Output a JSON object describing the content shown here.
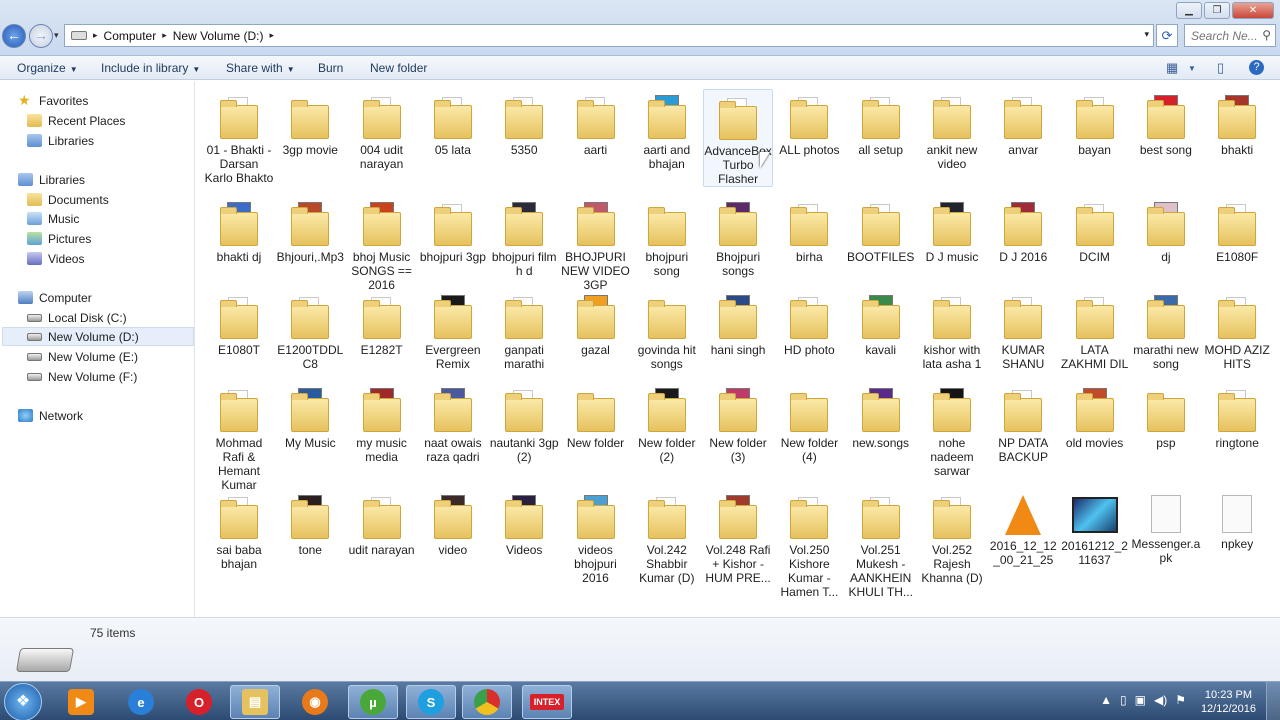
{
  "window": {
    "controls": [
      "minimize",
      "maximize",
      "close"
    ],
    "breadcrumbs": [
      "Computer",
      "New Volume (D:)"
    ],
    "search_placeholder": "Search Ne..."
  },
  "toolbar": {
    "organize": "Organize",
    "include": "Include in library",
    "share": "Share with",
    "burn": "Burn",
    "new_folder": "New folder"
  },
  "sidebar": {
    "favorites": "Favorites",
    "recent": "Recent Places",
    "libraries_fav": "Libraries",
    "libraries": "Libraries",
    "documents": "Documents",
    "music": "Music",
    "pictures": "Pictures",
    "videos": "Videos",
    "computer": "Computer",
    "local_c": "Local Disk (C:)",
    "new_d": "New Volume (D:)",
    "new_e": "New Volume (E:)",
    "new_f": "New Volume (F:)",
    "network": "Network"
  },
  "items": [
    {
      "name": "01 - Bhakti - Darsan Karlo Bhakto",
      "kind": "folder-doc"
    },
    {
      "name": "3gp movie",
      "kind": "folder"
    },
    {
      "name": "004  udit narayan",
      "kind": "folder-doc"
    },
    {
      "name": "05 lata",
      "kind": "folder-doc"
    },
    {
      "name": "5350",
      "kind": "folder-doc"
    },
    {
      "name": "aarti",
      "kind": "folder-doc"
    },
    {
      "name": "aarti and bhajan",
      "kind": "folder-img",
      "color": "#2a9bd6"
    },
    {
      "name": "AdvanceBox Turbo Flasher",
      "kind": "folder-doc"
    },
    {
      "name": "ALL photos",
      "kind": "folder-doc"
    },
    {
      "name": "all setup",
      "kind": "folder-doc"
    },
    {
      "name": "ankit new video",
      "kind": "folder-doc"
    },
    {
      "name": "anvar",
      "kind": "folder-doc"
    },
    {
      "name": "bayan",
      "kind": "folder-doc"
    },
    {
      "name": "best song",
      "kind": "folder-img",
      "color": "#d8202a"
    },
    {
      "name": "bhakti",
      "kind": "folder-img",
      "color": "#a8352a"
    },
    {
      "name": "bhakti dj",
      "kind": "folder-img",
      "color": "#3a6cc8"
    },
    {
      "name": "Bhjouri,.Mp3",
      "kind": "folder-img",
      "color": "#b84a2a"
    },
    {
      "name": "bhoj Music SONGS == 2016",
      "kind": "folder-img",
      "color": "#c8421e"
    },
    {
      "name": "bhojpuri 3gp",
      "kind": "folder-doc"
    },
    {
      "name": "bhojpuri film h d",
      "kind": "folder-img",
      "color": "#2a2a3a"
    },
    {
      "name": "BHOJPURI NEW VIDEO 3GP",
      "kind": "folder-img",
      "color": "#c05a6a"
    },
    {
      "name": "bhojpuri song",
      "kind": "folder"
    },
    {
      "name": "Bhojpuri songs",
      "kind": "folder-img",
      "color": "#5a2a6a"
    },
    {
      "name": "birha",
      "kind": "folder-doc"
    },
    {
      "name": "BOOTFILES",
      "kind": "folder-doc"
    },
    {
      "name": "D J music",
      "kind": "folder-img",
      "color": "#20242c"
    },
    {
      "name": "D J 2016",
      "kind": "folder-img",
      "color": "#a02a3a"
    },
    {
      "name": "DCIM",
      "kind": "folder-doc"
    },
    {
      "name": "dj",
      "kind": "folder-img",
      "color": "#e0c0c8"
    },
    {
      "name": "E1080F",
      "kind": "folder-doc"
    },
    {
      "name": "E1080T",
      "kind": "folder-doc"
    },
    {
      "name": "E1200TDDLC8",
      "kind": "folder-doc"
    },
    {
      "name": "E1282T",
      "kind": "folder-doc"
    },
    {
      "name": "Evergreen Remix",
      "kind": "folder-img",
      "color": "#1a1a1a"
    },
    {
      "name": "ganpati marathi",
      "kind": "folder-doc"
    },
    {
      "name": "gazal",
      "kind": "folder-img",
      "color": "#f0a020"
    },
    {
      "name": "govinda hit songs",
      "kind": "folder"
    },
    {
      "name": "hani singh",
      "kind": "folder-img",
      "color": "#2a4a8a"
    },
    {
      "name": "HD photo",
      "kind": "folder-doc"
    },
    {
      "name": "kavali",
      "kind": "folder-img",
      "color": "#3a8a4a"
    },
    {
      "name": "kishor with lata asha 1",
      "kind": "folder-doc"
    },
    {
      "name": "KUMAR SHANU",
      "kind": "folder-doc"
    },
    {
      "name": "LATA ZAKHMI DIL",
      "kind": "folder-doc"
    },
    {
      "name": "marathi new song",
      "kind": "folder-img",
      "color": "#3a6aaa"
    },
    {
      "name": "MOHD AZIZ HITS",
      "kind": "folder-doc"
    },
    {
      "name": "Mohmad Rafi & Hemant Kumar",
      "kind": "folder-doc"
    },
    {
      "name": "My Music",
      "kind": "folder-img",
      "color": "#2a5aa0"
    },
    {
      "name": "my music media",
      "kind": "folder-img",
      "color": "#a02a2a"
    },
    {
      "name": "naat owais raza qadri",
      "kind": "folder-img",
      "color": "#4a5aa0"
    },
    {
      "name": "nautanki 3gp (2)",
      "kind": "folder-doc"
    },
    {
      "name": "New folder",
      "kind": "folder"
    },
    {
      "name": "New folder (2)",
      "kind": "folder-img",
      "color": "#1a1a1a"
    },
    {
      "name": "New folder (3)",
      "kind": "folder-img",
      "color": "#c03a6a"
    },
    {
      "name": "New folder (4)",
      "kind": "folder"
    },
    {
      "name": "new.songs",
      "kind": "folder-img",
      "color": "#5a2a8a"
    },
    {
      "name": "nohe nadeem sarwar",
      "kind": "folder-img",
      "color": "#151515"
    },
    {
      "name": "NP DATA BACKUP",
      "kind": "folder-doc"
    },
    {
      "name": "old movies",
      "kind": "folder-img",
      "color": "#c04a2a"
    },
    {
      "name": "psp",
      "kind": "folder"
    },
    {
      "name": "ringtone",
      "kind": "folder-doc"
    },
    {
      "name": "sai baba bhajan",
      "kind": "folder-doc"
    },
    {
      "name": "tone",
      "kind": "folder-img",
      "color": "#2a2020"
    },
    {
      "name": "udit narayan",
      "kind": "folder-doc"
    },
    {
      "name": "video",
      "kind": "folder-img",
      "color": "#3a2a2a"
    },
    {
      "name": "Videos",
      "kind": "folder-img",
      "color": "#2a2040"
    },
    {
      "name": "videos bhojpuri 2016",
      "kind": "folder-img",
      "color": "#4aa0d0"
    },
    {
      "name": "Vol.242 Shabbir Kumar (D)",
      "kind": "folder-doc"
    },
    {
      "name": "Vol.248 Rafi + Kishor - HUM PRE...",
      "kind": "folder-img",
      "color": "#a03a2a"
    },
    {
      "name": "Vol.250 Kishore Kumar - Hamen T...",
      "kind": "folder-doc"
    },
    {
      "name": "Vol.251 Mukesh - AANKHEIN KHULI TH...",
      "kind": "folder-doc"
    },
    {
      "name": "Vol.252 Rajesh Khanna (D)",
      "kind": "folder-doc"
    },
    {
      "name": "2016_12_12_00_21_25",
      "kind": "vlc"
    },
    {
      "name": "20161212_211637",
      "kind": "image"
    },
    {
      "name": "Messenger.apk",
      "kind": "file"
    },
    {
      "name": "npkey",
      "kind": "file"
    }
  ],
  "status": {
    "count": "75 items"
  },
  "taskbar": {
    "apps": [
      "start",
      "media-player",
      "internet-explorer",
      "opera",
      "explorer",
      "firefox",
      "utorrent",
      "skype",
      "chrome",
      "intex"
    ],
    "intex_label": "INTEX",
    "time": "10:23 PM",
    "date": "12/12/2016"
  }
}
